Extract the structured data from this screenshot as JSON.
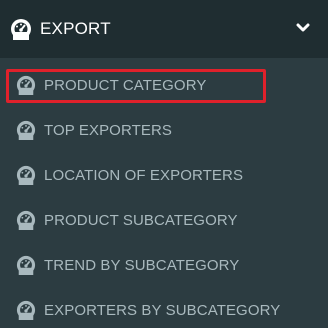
{
  "header": {
    "title": "EXPORT",
    "icon": "dashboard-icon",
    "toggle_icon": "chevron-down-icon"
  },
  "submenu": {
    "items": [
      {
        "label": "PRODUCT CATEGORY",
        "icon": "dashboard-icon",
        "selected": true
      },
      {
        "label": "TOP EXPORTERS",
        "icon": "dashboard-icon",
        "selected": false
      },
      {
        "label": "LOCATION OF EXPORTERS",
        "icon": "dashboard-icon",
        "selected": false
      },
      {
        "label": "PRODUCT SUBCATEGORY",
        "icon": "dashboard-icon",
        "selected": false
      },
      {
        "label": "TREND BY SUBCATEGORY",
        "icon": "dashboard-icon",
        "selected": false
      },
      {
        "label": "EXPORTERS BY SUBCATEGORY",
        "icon": "dashboard-icon",
        "selected": false
      }
    ]
  },
  "colors": {
    "header_bg": "#1f2d31",
    "menu_bg": "#2c3c41",
    "item_text": "#a9b9be",
    "header_text": "#ffffff",
    "highlight": "#e0212b"
  }
}
